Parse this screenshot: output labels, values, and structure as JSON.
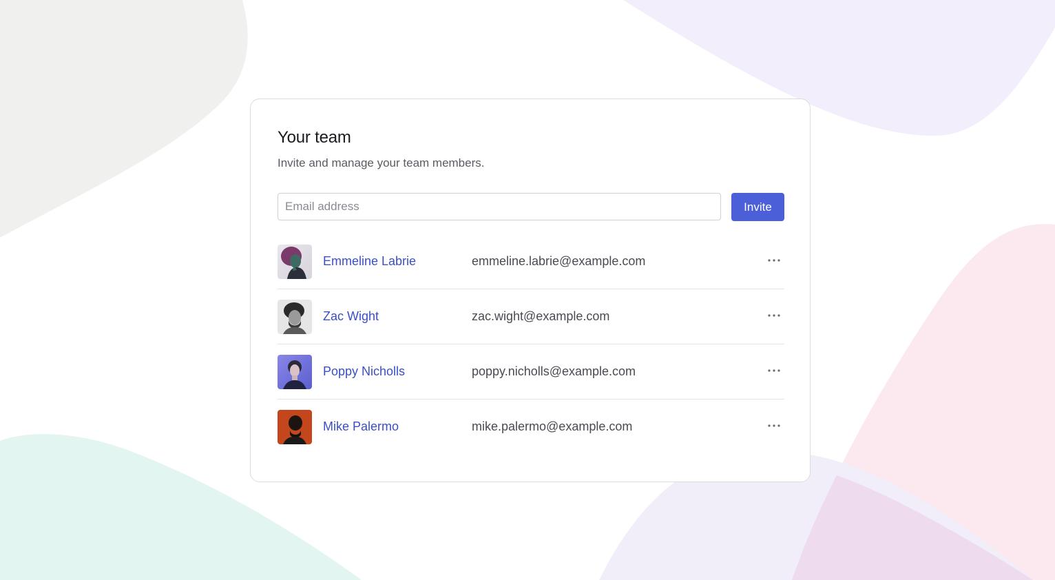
{
  "card": {
    "title": "Your team",
    "subtitle": "Invite and manage your team members."
  },
  "invite": {
    "placeholder": "Email address",
    "value": "",
    "button_label": "Invite"
  },
  "colors": {
    "accent": "#4a5fd8",
    "link": "#3a4fc4"
  },
  "members": [
    {
      "name": "Emmeline Labrie",
      "email": "emmeline.labrie@example.com",
      "avatar_icon": "avatar-image",
      "more_icon": "more-horizontal-icon"
    },
    {
      "name": "Zac Wight",
      "email": "zac.wight@example.com",
      "avatar_icon": "avatar-image",
      "more_icon": "more-horizontal-icon"
    },
    {
      "name": "Poppy Nicholls",
      "email": "poppy.nicholls@example.com",
      "avatar_icon": "avatar-image",
      "more_icon": "more-horizontal-icon"
    },
    {
      "name": "Mike Palermo",
      "email": "mike.palermo@example.com",
      "avatar_icon": "avatar-image",
      "more_icon": "more-horizontal-icon"
    }
  ]
}
